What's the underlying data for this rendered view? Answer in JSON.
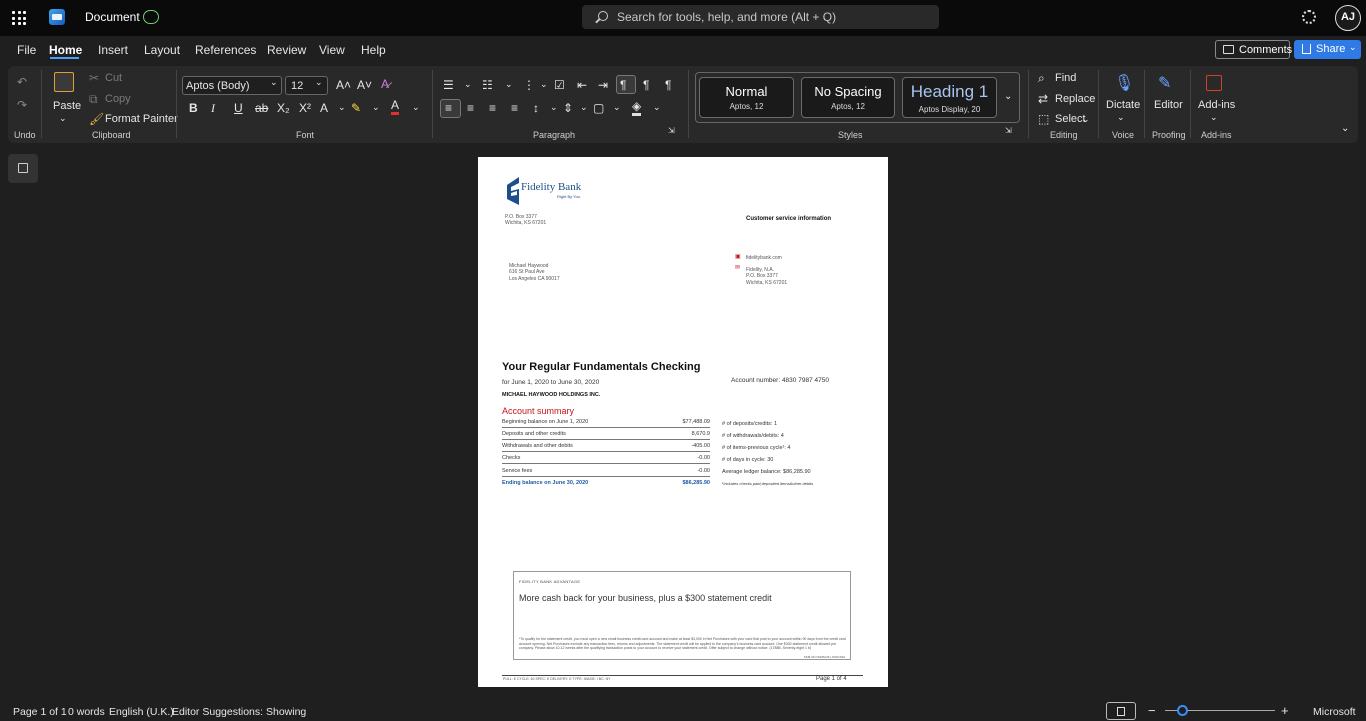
{
  "titlebar": {
    "doc_title": "Document",
    "search_placeholder": "Search for tools, help, and more (Alt + Q)",
    "avatar_initials": "AJ"
  },
  "menu": [
    "File",
    "Home",
    "Insert",
    "Layout",
    "References",
    "Review",
    "View",
    "Help"
  ],
  "menu_active": "Home",
  "actions": {
    "comments": "Comments",
    "share": "Share"
  },
  "ribbon": {
    "groups": {
      "undo": "Undo",
      "clipboard": "Clipboard",
      "font": "Font",
      "paragraph": "Paragraph",
      "styles": "Styles",
      "editing": "Editing",
      "voice": "Voice",
      "proofing": "Proofing",
      "addins": "Add-ins"
    },
    "clipboard": {
      "paste": "Paste",
      "cut": "Cut",
      "copy": "Copy",
      "format_painter": "Format Painter"
    },
    "font": {
      "family": "Aptos (Body)",
      "size": "12"
    },
    "styles": [
      {
        "name": "Normal",
        "sub": "Aptos, 12"
      },
      {
        "name": "No Spacing",
        "sub": "Aptos, 12"
      },
      {
        "name": "Heading 1",
        "sub": "Aptos Display, 20"
      }
    ],
    "editing": {
      "find": "Find",
      "replace": "Replace",
      "select": "Select"
    },
    "dictate": "Dictate",
    "editor": "Editor",
    "addins": "Add-ins"
  },
  "document": {
    "logo_name": "Fidelity Bank",
    "logo_tag": "Right By You.",
    "return_address": [
      "P.O. Box 3377",
      "Wichita, KS 67201"
    ],
    "recipient": [
      "Michael Haywood",
      "616 St Paul Ave",
      "Los Angeles CA 90017"
    ],
    "cs_title": "Customer service information",
    "cs_web": "fidelitybank.com",
    "cs_mail": [
      "Fidelity, N.A.",
      "P.O. Box 3377",
      "Wichita, KS 67201"
    ],
    "account_title": "Your Regular Fundamentals Checking",
    "period": "for June 1, 2020 to June 30, 2020",
    "account_number": "Account number: 4830 7987 4750",
    "holder": "MICHAEL HAYWOOD HOLDINGS INC.",
    "summary_title": "Account summary",
    "summary_rows": [
      {
        "label": "Beginning balance on June 1, 2020",
        "value": "$77,488.09"
      },
      {
        "label": "Deposits and other credits",
        "value": "8,670.9"
      },
      {
        "label": "Withdrawals and other debits",
        "value": "-405.00"
      },
      {
        "label": "Checks",
        "value": "-0.00"
      },
      {
        "label": "Service fees",
        "value": "-0.00"
      },
      {
        "label": "Ending balance on June 30, 2020",
        "value": "$86,285.90"
      }
    ],
    "stats": [
      "# of deposits/credits: 1",
      "# of withdrawals/debits: 4",
      "# of items-previous cycle¹: 4",
      "# of days in cycle: 30",
      "Average ledger balance: $86,285.90",
      "¹Includes checks paid,deposited items&other debits"
    ],
    "promo_header": "FIDELITY BANK ADVANTAGE",
    "promo_main": "More cash back for your business, plus a $300 statement credit",
    "promo_fine": "*To qualify for the statement credit, you must open a new small business credit card account and make at least $3,000 in Net Purchases with your card that post to your account within 90 days from the credit card account opening. Net Purchases exclude any transaction fees, returns and adjustments. The statement credit will be applied to the company's business card account. One $300 statement credit allowed per company. Please allow 10-12 weeks after the qualifying transaction posts to your account to receive your statement credit. Offer subject to change without notice. (1788B, Seventy-eight 1 b)",
    "promo_code": "SSM-09 OS495A B | AR4CX94",
    "footer_left": "PULL: E  CYCLE: 60  SPEC: E  DELIVERY: E  TYPE:  IMAGE: I  BC: NY",
    "page_label": "Page 1 of 4"
  },
  "status": {
    "page": "Page 1 of 1",
    "words": "0 words",
    "language": "English (U.K.)",
    "editor": "Editor Suggestions: Showing",
    "brand": "Microsoft"
  }
}
